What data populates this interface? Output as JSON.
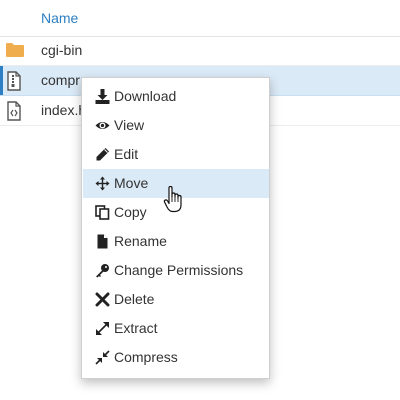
{
  "header": {
    "name_label": "Name"
  },
  "files": [
    {
      "name": "cgi-bin",
      "icon": "folder-icon"
    },
    {
      "name": "compr",
      "icon": "archive-file-icon"
    },
    {
      "name": "index.h",
      "icon": "code-file-icon"
    }
  ],
  "context_menu": {
    "items": [
      {
        "label": "Download",
        "icon": "download-icon"
      },
      {
        "label": "View",
        "icon": "eye-icon"
      },
      {
        "label": "Edit",
        "icon": "pencil-icon"
      },
      {
        "label": "Move",
        "icon": "move-arrows-icon"
      },
      {
        "label": "Copy",
        "icon": "copy-icon"
      },
      {
        "label": "Rename",
        "icon": "file-icon"
      },
      {
        "label": "Change Permissions",
        "icon": "key-icon"
      },
      {
        "label": "Delete",
        "icon": "x-icon"
      },
      {
        "label": "Extract",
        "icon": "expand-icon"
      },
      {
        "label": "Compress",
        "icon": "compress-icon"
      }
    ]
  },
  "colors": {
    "accent": "#2e7fc3",
    "folder": "#f0ad4e",
    "selected_bg": "#dbeaf7"
  }
}
